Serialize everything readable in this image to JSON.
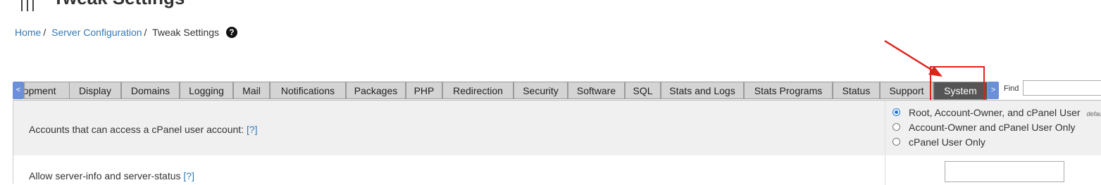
{
  "page": {
    "title": "Tweak Settings"
  },
  "breadcrumb": {
    "home": "Home",
    "server_configuration": "Server Configuration",
    "current": "Tweak Settings",
    "help": "?"
  },
  "tabs": {
    "scroll_left": "<",
    "scroll_right": ">",
    "items": [
      {
        "label": "Development"
      },
      {
        "label": "Display"
      },
      {
        "label": "Domains"
      },
      {
        "label": "Logging"
      },
      {
        "label": "Mail"
      },
      {
        "label": "Notifications"
      },
      {
        "label": "Packages"
      },
      {
        "label": "PHP"
      },
      {
        "label": "Redirection"
      },
      {
        "label": "Security"
      },
      {
        "label": "Software"
      },
      {
        "label": "SQL"
      },
      {
        "label": "Stats and Logs"
      },
      {
        "label": "Stats Programs"
      },
      {
        "label": "Status"
      },
      {
        "label": "Support"
      },
      {
        "label": "System",
        "active": true
      }
    ]
  },
  "find": {
    "label": "Find",
    "value": ""
  },
  "settings": {
    "row1": {
      "label": "Accounts that can access a cPanel user account:",
      "help_link": "[?]",
      "options": [
        {
          "label": "Root, Account-Owner, and cPanel User",
          "note": "default",
          "checked": true
        },
        {
          "label": "Account-Owner and cPanel User Only",
          "checked": false
        },
        {
          "label": "cPanel User Only",
          "checked": false
        }
      ]
    },
    "row2": {
      "label": "Allow server-info and server-status",
      "help_link": "[?]",
      "value": ""
    }
  },
  "annotation": {
    "color": "#e0221b"
  }
}
